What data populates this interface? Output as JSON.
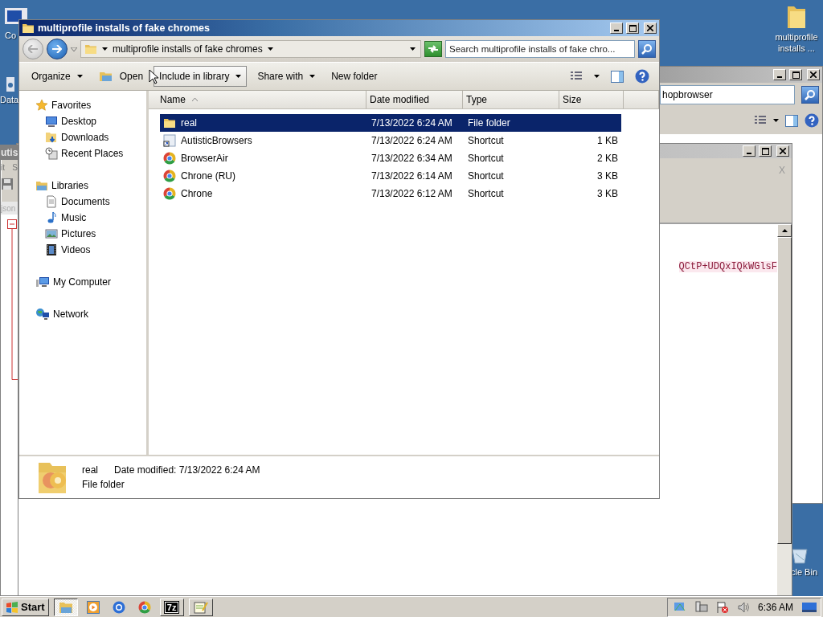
{
  "desktop": {
    "icons": [
      {
        "label": "Co",
        "kind": "computer"
      },
      {
        "label": "Data",
        "kind": "drive"
      },
      {
        "label": "multiprofile installs ...",
        "kind": "folder"
      },
      {
        "label": "cle Bin",
        "kind": "recycle"
      }
    ]
  },
  "left_window": {
    "title": "utis",
    "menu": [
      "it",
      "S"
    ],
    "field_value": "json"
  },
  "right_window": {
    "search_value": "hopbrowser"
  },
  "editor_window": {
    "close_mark": "X",
    "line": "QCtP+UDQxIQkWGlsF"
  },
  "explorer": {
    "title": "multiprofile installs of fake chromes",
    "active": true,
    "address": "multiprofile installs of fake chromes",
    "search_placeholder": "Search multiprofile installs of fake chro...",
    "toolbar": [
      {
        "label": "Organize",
        "kind": "menu",
        "hovered": false
      },
      {
        "label": "Open",
        "kind": "open",
        "hovered": false
      },
      {
        "label": "Include in library",
        "kind": "menu",
        "hovered": true
      },
      {
        "label": "Share with",
        "kind": "menu",
        "hovered": false
      },
      {
        "label": "New folder",
        "kind": "plain",
        "hovered": false
      }
    ],
    "sidebar": [
      {
        "label": "Favorites",
        "kind": "star",
        "children": [
          {
            "label": "Desktop",
            "kind": "desktop"
          },
          {
            "label": "Downloads",
            "kind": "downloads"
          },
          {
            "label": "Recent Places",
            "kind": "recent"
          }
        ]
      },
      {
        "label": "Libraries",
        "kind": "library",
        "children": [
          {
            "label": "Documents",
            "kind": "document"
          },
          {
            "label": "Music",
            "kind": "music"
          },
          {
            "label": "Pictures",
            "kind": "pictures"
          },
          {
            "label": "Videos",
            "kind": "videos"
          }
        ]
      },
      {
        "label": "My Computer",
        "kind": "computer"
      },
      {
        "label": "Network",
        "kind": "network"
      }
    ],
    "columns": [
      "Name",
      "Date modified",
      "Type",
      "Size"
    ],
    "rows": [
      {
        "name": "real",
        "date": "7/13/2022 6:24 AM",
        "type": "File folder",
        "kind": "folder",
        "selected": true
      },
      {
        "name": "AutisticBrowsers",
        "date": "7/13/2022 6:24 AM",
        "type": "Shortcut",
        "size": "1 KB",
        "kind": "shortcut",
        "selected": false
      },
      {
        "name": "BrowserAir",
        "date": "7/13/2022 6:34 AM",
        "type": "Shortcut",
        "size": "2 KB",
        "kind": "browser",
        "selected": false
      },
      {
        "name": "Chrone (RU)",
        "date": "7/13/2022 6:14 AM",
        "type": "Shortcut",
        "size": "3 KB",
        "kind": "browser",
        "selected": false
      },
      {
        "name": "Chrone",
        "date": "7/13/2022 6:12 AM",
        "type": "Shortcut",
        "size": "3 KB",
        "kind": "browser",
        "selected": false
      }
    ],
    "details": {
      "name": "real",
      "date_label": "Date modified:",
      "date": "7/13/2022 6:24 AM",
      "type": "File folder"
    }
  },
  "taskbar": {
    "start": "Start",
    "apps": [
      {
        "kind": "explorer",
        "open": true,
        "active": true
      },
      {
        "kind": "media",
        "open": false,
        "active": false
      },
      {
        "kind": "browser-blue",
        "open": false,
        "active": false
      },
      {
        "kind": "browser",
        "open": false,
        "active": false
      },
      {
        "kind": "archiver",
        "label": "7z",
        "open": true,
        "active": false
      },
      {
        "kind": "notepad",
        "open": true,
        "active": false
      }
    ],
    "clock": "6:36 AM"
  }
}
